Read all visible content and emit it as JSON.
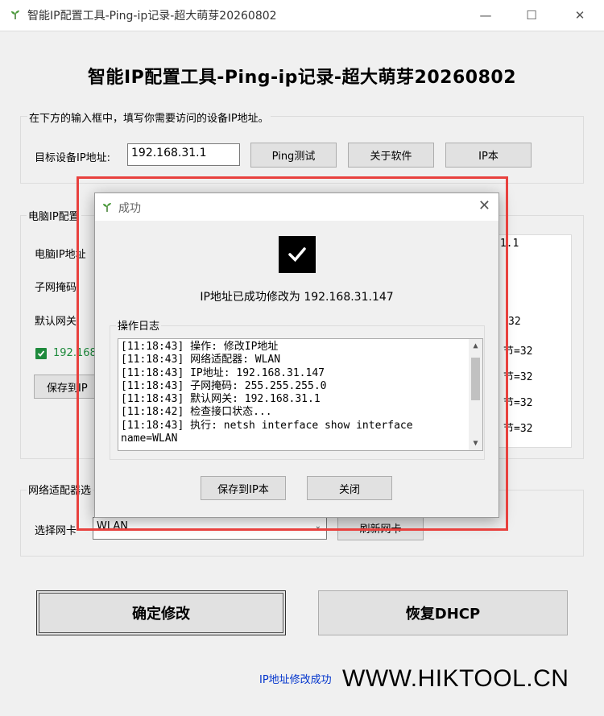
{
  "window": {
    "title": "智能IP配置工具-Ping-ip记录-超大萌芽20260802",
    "minimize": "—",
    "maximize": "☐",
    "close": "✕"
  },
  "main_title": "智能IP配置工具-Ping-ip记录-超大萌芽20260802",
  "target_group": {
    "hint": "在下方的输入框中，填写你需要访问的设备IP地址。",
    "ip_label": "目标设备IP地址:",
    "ip_value": "192.168.31.1",
    "ping_button": "Ping测试",
    "about_button": "关于软件",
    "ipbook_button": "IP本"
  },
  "pc_group": {
    "title": "电脑IP配置",
    "ip_label": "电脑IP地址",
    "mask_label": "子网掩码:",
    "gateway_label": "默认网关:",
    "green_text": "192.168",
    "save_button_partial": "保存到IP",
    "list_rows": [
      ".1.1",
      "32",
      "节=32",
      "节=32",
      "节=32",
      "节=32"
    ]
  },
  "adapter_group": {
    "title": "网络适配器选",
    "select_label": "选择网卡",
    "select_value": "WLAN",
    "refresh_button": "刷新网卡"
  },
  "actions": {
    "apply_button": "确定修改",
    "dhcp_button": "恢复DHCP"
  },
  "status_text": "IP地址修改成功",
  "watermark": "WWW.HIKTOOL.CN",
  "dialog": {
    "title": "成功",
    "message": "IP地址已成功修改为 192.168.31.147",
    "log_label": "操作日志",
    "log_lines": [
      "[11:18:43] 操作: 修改IP地址",
      "[11:18:43] 网络适配器: WLAN",
      "[11:18:43] IP地址: 192.168.31.147",
      "[11:18:43] 子网掩码: 255.255.255.0",
      "[11:18:43] 默认网关: 192.168.31.1",
      "[11:18:42] 检查接口状态...",
      "[11:18:43] 执行: netsh interface show interface",
      "name=WLAN"
    ],
    "save_button": "保存到IP本",
    "close_button": "关闭"
  },
  "colors": {
    "highlight": "#e8413e",
    "status": "#0033cc",
    "check": "#1e8a3c"
  }
}
